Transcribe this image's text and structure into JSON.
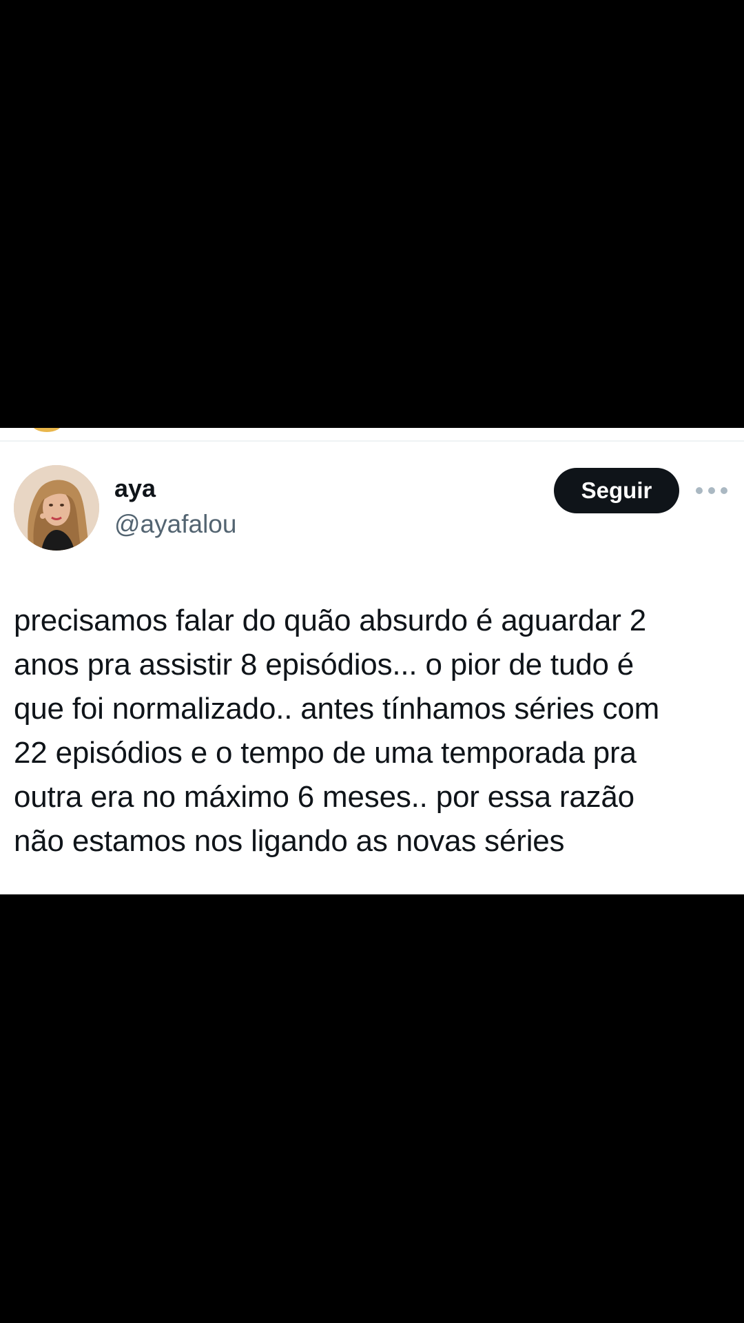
{
  "colors": {
    "background": "#000000",
    "card": "#ffffff",
    "text_primary": "#0f1419",
    "text_secondary": "#536471",
    "button_bg": "#0f1419",
    "button_text": "#ffffff"
  },
  "tweet": {
    "author": {
      "display_name": "aya",
      "handle": "@ayafalou",
      "avatar_icon": "profile-photo"
    },
    "follow_label": "Seguir",
    "more_icon": "more-horizontal-icon",
    "text_lines": [
      "precisamos falar do quão absurdo é aguardar 2",
      "anos pra assistir 8 episódios... o pior de tudo é",
      "que foi normalizado.. antes tínhamos séries com",
      "22 episódios e o tempo de uma temporada pra",
      "outra era no máximo 6 meses.. por essa razão",
      "não estamos nos ligando as novas séries"
    ]
  }
}
